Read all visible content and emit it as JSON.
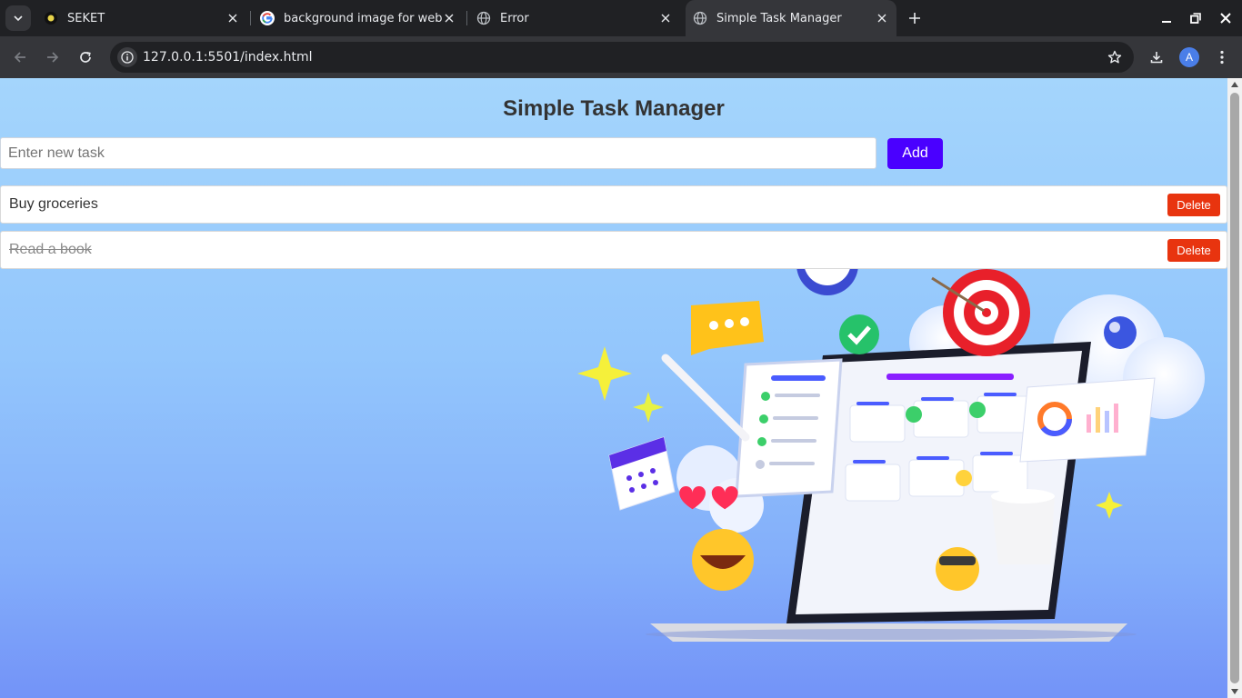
{
  "browser": {
    "tabs": [
      {
        "title": "SEKET",
        "favicon": "seket-logo-icon",
        "active": false
      },
      {
        "title": "background image for websit",
        "favicon": "google-icon",
        "active": false
      },
      {
        "title": "Error",
        "favicon": "globe-icon",
        "active": false
      },
      {
        "title": "Simple Task Manager",
        "favicon": "globe-icon",
        "active": true
      }
    ],
    "url": "127.0.0.1:5501/index.html",
    "profile_initial": "A"
  },
  "app": {
    "title": "Simple Task Manager",
    "input": {
      "value": "",
      "placeholder": "Enter new task"
    },
    "add_label": "Add",
    "tasks": [
      {
        "text": "Buy groceries",
        "completed": false,
        "delete_label": "Delete"
      },
      {
        "text": "Read a book",
        "completed": true,
        "delete_label": "Delete"
      }
    ]
  },
  "colors": {
    "accent": "#4a00ff",
    "delete": "#e8340f",
    "bg_top": "#a4d5fc",
    "bg_bottom": "#7393f8"
  }
}
